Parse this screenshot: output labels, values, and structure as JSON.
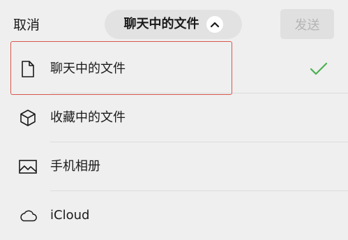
{
  "header": {
    "cancel_label": "取消",
    "title": "聊天中的文件",
    "send_label": "发送"
  },
  "list": {
    "items": [
      {
        "label": "聊天中的文件",
        "icon": "document-icon",
        "selected": true
      },
      {
        "label": "收藏中的文件",
        "icon": "cube-icon",
        "selected": false
      },
      {
        "label": "手机相册",
        "icon": "image-icon",
        "selected": false
      },
      {
        "label": "iCloud",
        "icon": "cloud-icon",
        "selected": false
      }
    ]
  },
  "colors": {
    "background": "#efefef",
    "check": "#4caf50",
    "highlight_border": "#d9564b",
    "send_disabled_text": "#b4b4b4"
  }
}
